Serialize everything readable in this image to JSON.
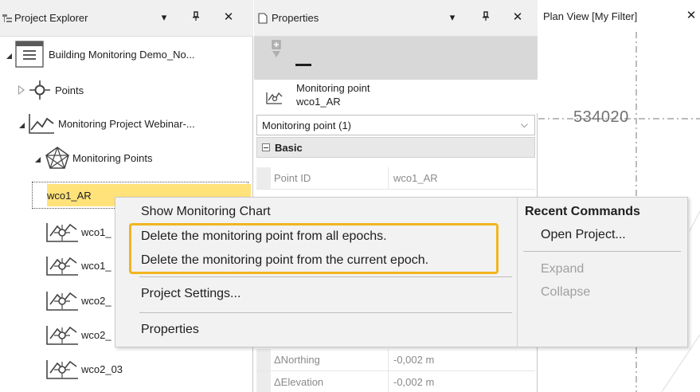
{
  "explorer": {
    "title": "Project Explorer",
    "tree": [
      {
        "label": "Building  Monitoring  Demo_No..."
      },
      {
        "label": "Points"
      },
      {
        "label": "Monitoring  Project  Webinar-..."
      },
      {
        "label": "Monitoring Points"
      },
      {
        "label": "wco1_AR"
      },
      {
        "label": "wco1_"
      },
      {
        "label": "wco1_"
      },
      {
        "label": "wco2_"
      },
      {
        "label": "wco2_"
      },
      {
        "label": "wco2_03"
      }
    ]
  },
  "properties": {
    "title": "Properties",
    "object_type": "Monitoring point",
    "object_name": "wco1_AR",
    "selector": "Monitoring point (1)",
    "category": "Basic",
    "rows": [
      {
        "key": "Point ID",
        "value": "wco1_AR"
      },
      {
        "key": "ΔNorthing",
        "value": "-0,002 m"
      },
      {
        "key": "ΔElevation",
        "value": "-0,002 m"
      }
    ]
  },
  "plan_view": {
    "title": "Plan View [My Filter]",
    "coordinate_label": "534020"
  },
  "context_menu": {
    "items": [
      {
        "label": "Show Monitoring Chart"
      },
      {
        "label": "Delete the monitoring point from all epochs."
      },
      {
        "label": "Delete the monitoring point from the current epoch."
      },
      {
        "label": "Project Settings..."
      },
      {
        "label": "Properties"
      }
    ],
    "recent": {
      "header": "Recent Commands",
      "items": [
        {
          "label": "Open Project...",
          "enabled": true
        },
        {
          "label": "Expand",
          "enabled": false
        },
        {
          "label": "Collapse",
          "enabled": false
        }
      ]
    },
    "highlight_color": "#f2b51f"
  },
  "icons": {
    "dropdown": "chevron-down-icon",
    "pin": "pin-icon",
    "close": "close-icon"
  }
}
